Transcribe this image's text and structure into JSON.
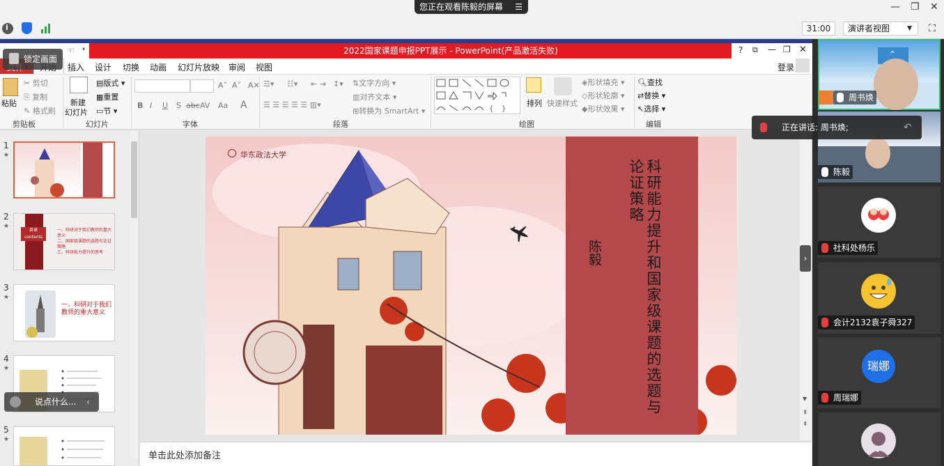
{
  "meeting": {
    "screen_banner": "您正在观看陈毅的屏幕",
    "timer": "31:00",
    "view_mode": "演讲者视图",
    "speaking_now": "正在讲话: 周书焕;"
  },
  "ppt": {
    "window_title": "2022国家课题申报PPT展示 - PowerPoint(产品激活失败)",
    "lock_label": "锁定画面",
    "file_label": "文件",
    "start_label": "开始",
    "tabs": [
      "插入",
      "设计",
      "切换",
      "动画",
      "幻灯片放映",
      "审阅",
      "视图"
    ],
    "login": "登录",
    "ribbon": {
      "paste": "粘贴",
      "cut": "剪切",
      "copy": "复制",
      "format_painter": "格式刷",
      "new_slide": "新建",
      "new_slide2": "幻灯片",
      "layout": "版式",
      "reset": "重置",
      "section": "节",
      "text_direction": "文字方向",
      "align_text": "对齐文本",
      "smartart": "转换为 SmartArt",
      "arrange": "排列",
      "quick_styles": "快速样式",
      "shape_fill": "形状填充",
      "shape_outline": "形状轮廓",
      "shape_effects": "形状效果",
      "find": "查找",
      "replace": "替换",
      "select": "选择",
      "groups": [
        "剪贴板",
        "幻灯片",
        "字体",
        "段落",
        "绘图",
        "编辑"
      ]
    },
    "thumbnails": [
      {
        "num": "1"
      },
      {
        "num": "2",
        "label": "目录\ncontents",
        "items": [
          "一、科研对于我们教师的重大意义",
          "二、国家级课题的选题与论证策略",
          "三、科研能力提升的思考"
        ]
      },
      {
        "num": "3",
        "text": "一、科研对于我们教师的重大意义"
      },
      {
        "num": "4"
      },
      {
        "num": "5"
      }
    ],
    "slide": {
      "school": "华东政法大学",
      "title": "科研能力提升和国家级课题的选题与论证策略",
      "author": "陈毅"
    },
    "notes_placeholder": "单击此处添加备注",
    "chat_placeholder": "说点什么..."
  },
  "participants": [
    {
      "name": "周书焕"
    },
    {
      "name": "陈毅"
    },
    {
      "name": "社科处杨乐"
    },
    {
      "name": "会计2132袁子舜327"
    },
    {
      "name": "周瑞娜",
      "initials": "瑞娜"
    },
    {
      "name": ""
    }
  ],
  "colors": {
    "ppt_red": "#e21b23",
    "slide_band": "#b5484a",
    "dark_panel": "#2d2d2d",
    "avatar_blue": "#1e6fe8"
  }
}
